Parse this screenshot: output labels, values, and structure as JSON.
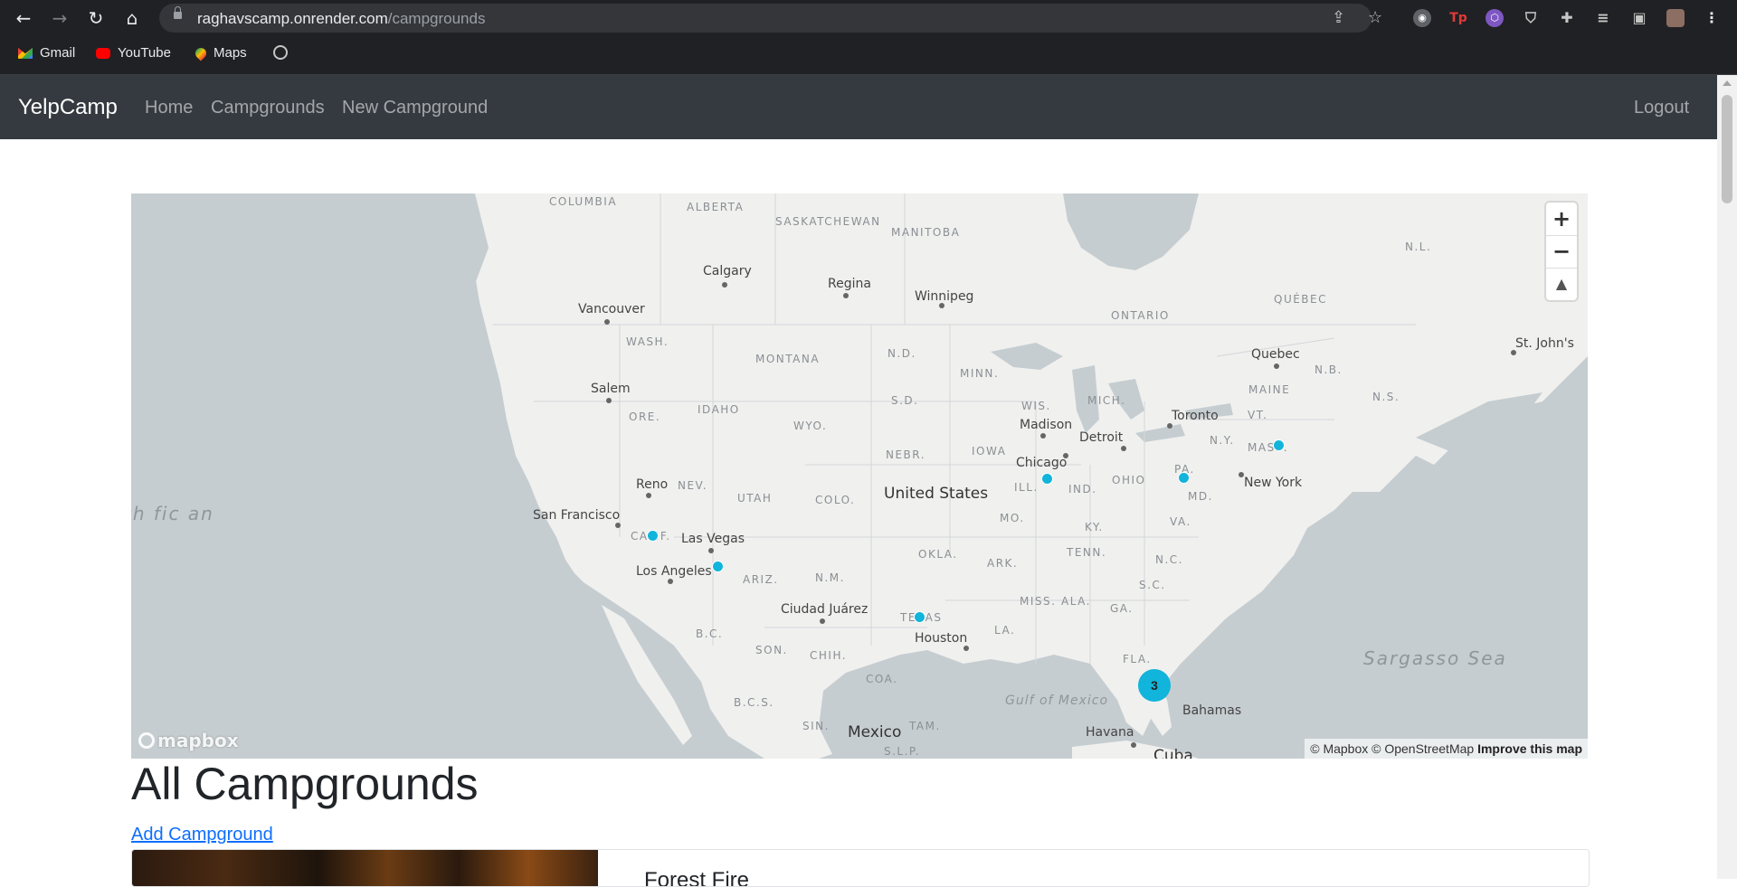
{
  "browser": {
    "url_domain": "raghavscamp.onrender.com",
    "url_path": "/campgrounds",
    "bookmarks": [
      {
        "label": "Gmail",
        "icon": "gmail-icon"
      },
      {
        "label": "YouTube",
        "icon": "youtube-icon"
      },
      {
        "label": "Maps",
        "icon": "maps-icon"
      }
    ],
    "extension_tp_label": "Tp"
  },
  "navbar": {
    "brand": "YelpCamp",
    "links": [
      "Home",
      "Campgrounds",
      "New Campground"
    ],
    "logout": "Logout"
  },
  "map": {
    "regions": [
      "COLUMBIA",
      "ALBERTA",
      "SASKATCHEWAN",
      "MANITOBA",
      "ONTARIO",
      "QUÉBEC",
      "N.L.",
      "N.B.",
      "N.S.",
      "MAINE",
      "VT.",
      "N.Y.",
      "MASS.",
      "PA.",
      "WASH.",
      "MONTANA",
      "N.D.",
      "MINN.",
      "WIS.",
      "MICH.",
      "S.D.",
      "IOWA",
      "NEBR.",
      "ORE.",
      "IDAHO",
      "WYO.",
      "NEV.",
      "UTAH",
      "COLO.",
      "ILL.",
      "IND.",
      "OHIO",
      "MD.",
      "VA.",
      "CALIF.",
      "ARIZ.",
      "N.M.",
      "OKLA.",
      "ARK.",
      "KY.",
      "TENN.",
      "N.C.",
      "S.C.",
      "GA.",
      "ALA.",
      "MISS.",
      "LA.",
      "TEXAS",
      "FLA.",
      "MO.",
      "SON.",
      "CHIH.",
      "COA.",
      "B.C.",
      "B.C.S.",
      "SIN.",
      "TAM.",
      "S.L.P."
    ],
    "cities": [
      "Calgary",
      "Regina",
      "Winnipeg",
      "Vancouver",
      "Salem",
      "Reno",
      "San Francisco",
      "Las Vegas",
      "Los Angeles",
      "Ciudad Juárez",
      "Houston",
      "Chicago",
      "Madison",
      "Detroit",
      "Toronto",
      "Quebec",
      "St. John's",
      "New York",
      "Havana",
      "Mexico",
      "Bahamas",
      "Cuba"
    ],
    "countries": [
      "United States",
      "Mexico"
    ],
    "seas": [
      "Sargasso Sea",
      "Gulf of Mexico",
      "th fic an"
    ],
    "cluster_count": "3",
    "logo": "mapbox",
    "attribution": "© Mapbox © OpenStreetMap",
    "improve": "Improve this map"
  },
  "page": {
    "title": "All Campgrounds",
    "add_link": "Add Campground",
    "first_card_title": "Forest Fire"
  }
}
